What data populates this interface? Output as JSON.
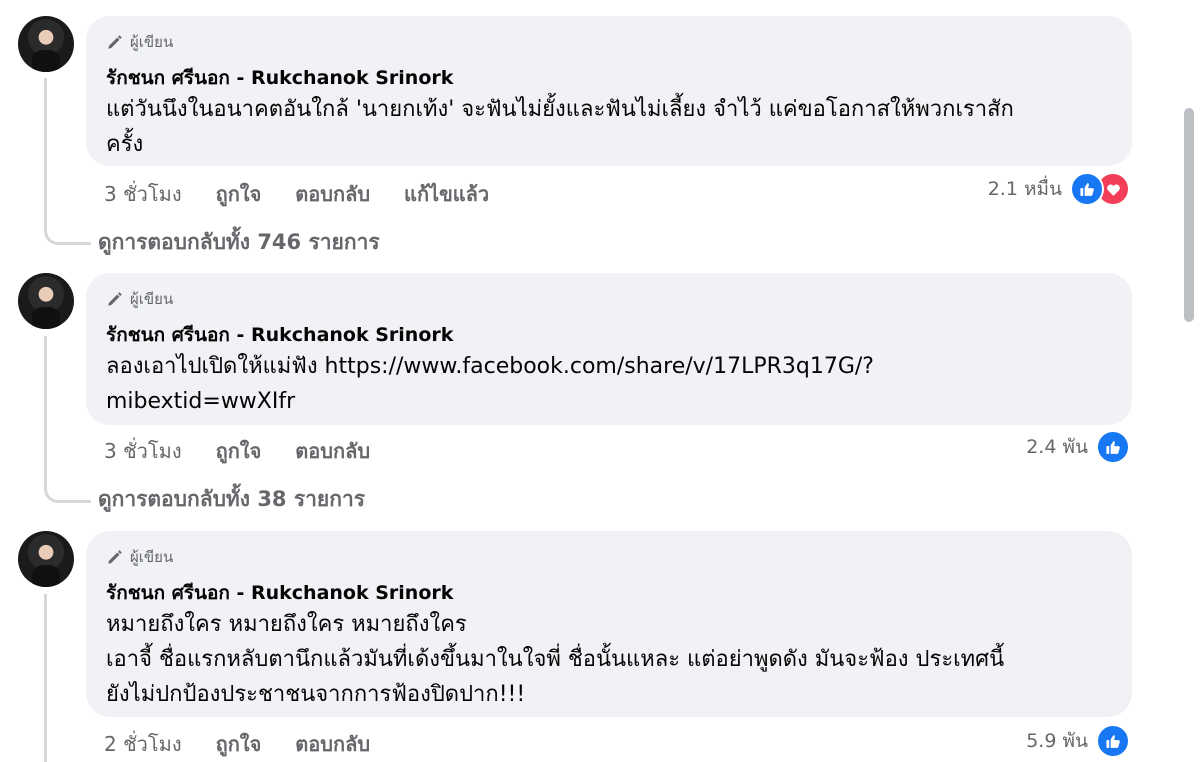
{
  "badge_label": "ผู้เขียน",
  "comments": [
    {
      "author": "รักชนก ศรีนอก - Rukchanok Srinork",
      "line1": "แต่วันนึงในอนาคตอันใกล้ 'นายกเท้ง' จะฟันไม่ยั้งและฟันไม่เลี้ยง จำไว้ แค่ขอโอกาสให้พวกเราสัก",
      "line2": "ครั้ง",
      "time": "3 ชั่วโมง",
      "like": "ถูกใจ",
      "reply": "ตอบกลับ",
      "edited": "แก้ไขแล้ว",
      "reaction_count": "2.1 หมื่น",
      "view_replies": "ดูการตอบกลับทั้ง 746 รายการ"
    },
    {
      "author": "รักชนก ศรีนอก - Rukchanok Srinork",
      "line1": "ลองเอาไปเปิดให้แม่ฟัง https://www.facebook.com/share/v/17LPR3q17G/?",
      "line2": "mibextid=wwXIfr",
      "time": "3 ชั่วโมง",
      "like": "ถูกใจ",
      "reply": "ตอบกลับ",
      "reaction_count": "2.4 พัน",
      "view_replies": "ดูการตอบกลับทั้ง 38 รายการ"
    },
    {
      "author": "รักชนก ศรีนอก - Rukchanok Srinork",
      "line1": "หมายถึงใคร หมายถึงใคร หมายถึงใคร",
      "line2": "เอาจี้ ชื่อแรกหลับตานึกแล้วมันที่เด้งขึ้นมาในใจพี่ ชื่อนั้นแหละ แต่อย่าพูดดัง มันจะฟ้อง ประเทศนี้",
      "line3": "ยังไม่ปกป้องประชาชนจากการฟ้องปิดปาก!!!",
      "time": "2 ชั่วโมง",
      "like": "ถูกใจ",
      "reply": "ตอบกลับ",
      "reaction_count": "5.9 พัน"
    }
  ],
  "colors": {
    "bubble": "#f0f2f5",
    "secondary_text": "#65676b",
    "like_blue": "#1877f2",
    "love_red": "#f33e58"
  }
}
